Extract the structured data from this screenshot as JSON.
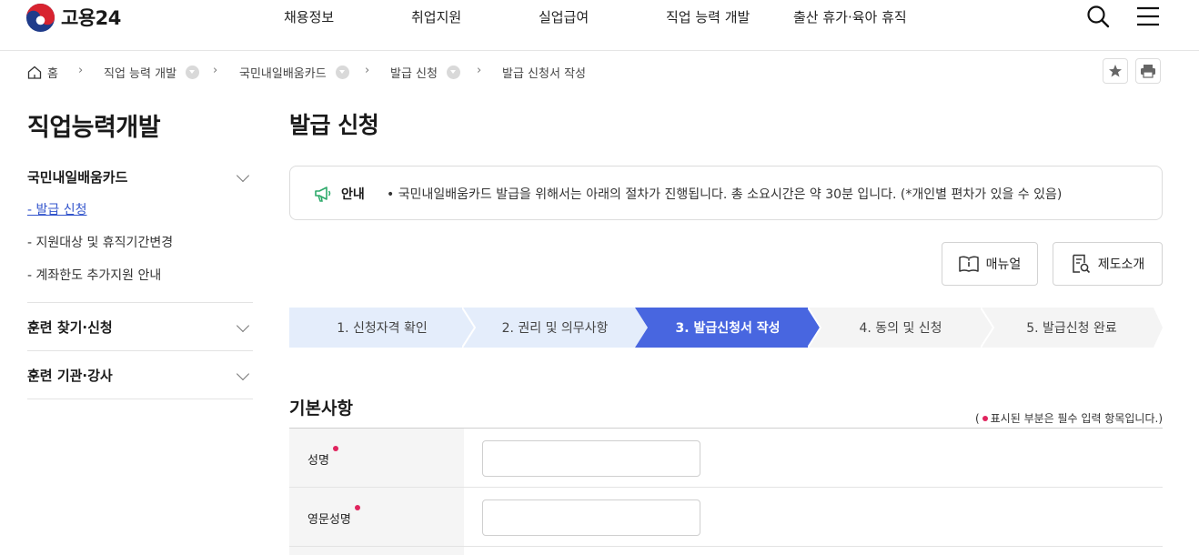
{
  "header": {
    "logo_text": "고용24",
    "nav": [
      "채용정보",
      "취업지원",
      "실업급여",
      "직업 능력 개발",
      "출산 휴가·육아 휴직"
    ],
    "icons": [
      "search-icon",
      "menu-icon"
    ]
  },
  "breadcrumb": {
    "home": "홈",
    "items": [
      "직업 능력 개발",
      "국민내일배움카드",
      "발급 신청",
      "발급 신청서 작성"
    ]
  },
  "sidebar": {
    "title": "직업능력개발",
    "groups": [
      {
        "label": "국민내일배움카드",
        "items": [
          "- 발급 신청",
          "- 지원대상 및 휴직기간변경",
          "- 계좌한도 추가지원 안내"
        ]
      },
      {
        "label": "훈련 찾기·신청"
      },
      {
        "label": "훈련 기관·강사"
      }
    ]
  },
  "main": {
    "title": "발급 신청",
    "notice": {
      "label": "안내",
      "text": "• 국민내일배움카드 발급을 위해서는 아래의 절차가 진행됩니다. 총 소요시간은 약 30분 입니다. (*개인별 편차가 있을 수 있음)"
    },
    "buttons": {
      "manual": "매뉴얼",
      "intro": "제도소개"
    },
    "steps": [
      "1. 신청자격 확인",
      "2. 권리 및 의무사항",
      "3. 발급신청서 작성",
      "4. 동의 및 신청",
      "5. 발급신청 완료"
    ],
    "current_step": 3,
    "section": {
      "title": "기본사항",
      "required_note_prefix": "(",
      "required_note": "표시된 부분은 필수 입력 항목입니다.)",
      "fields": [
        {
          "label": "성명",
          "value": ""
        },
        {
          "label": "영문성명",
          "value": ""
        }
      ]
    }
  },
  "colors": {
    "accent": "#4866e0",
    "done_step": "#e4edfb",
    "pending_step": "#f4f4f4",
    "required": "#e0245e"
  }
}
